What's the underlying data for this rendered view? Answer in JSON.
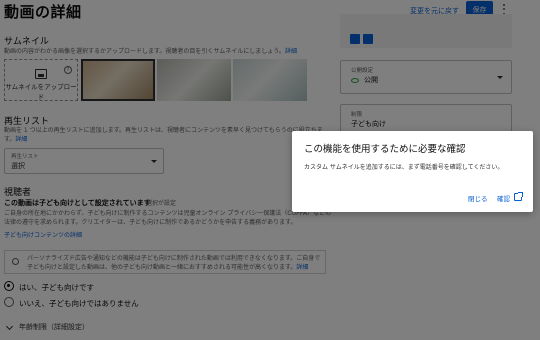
{
  "header": {
    "title": "動画の詳細",
    "undo_label": "変更を元に戻す",
    "save_label": "保存"
  },
  "thumbnail": {
    "title": "サムネイル",
    "desc": "動画の内容がわかる画像を選択するかアップロードします。視聴者の目を引くサムネイルにしましょう。",
    "desc_link": "詳細",
    "upload_label": "サムネイルをアップロード",
    "info_symbol": "?"
  },
  "playlist": {
    "title": "再生リスト",
    "desc_line1": "動画を 1 つ以上の再生リストに追加します。再生リストは、視聴者にコンテンツを素早く見つけてもらうのに役立ちます。",
    "desc_link": "詳細",
    "select_label": "再生リスト",
    "select_value": "選択"
  },
  "audience": {
    "title": "視聴者",
    "status": "この動画は子ども向けとして設定されています",
    "change_label": "選択が設定",
    "desc": "ご自身の所在地にかかわらず、子ども向けに制作するコンテンツは児童オンライン プライバシー保護法（COPPA）などの法律の遵守を求められます。クリエイターは、子ども向けに制作であるかどうかを申告する義務があります。",
    "desc_link": "子ども向けコンテンツの詳細",
    "note": "パーソナライズド広告や通知などの機能は子ども向けに制作された動画では利用できなくなります。ご自身で子ども向けと設定した動画は、他の子ども向け動画と一緒におすすめされる可能性が高くなります。",
    "note_link": "詳細",
    "option_yes": "はい、子ども向けです",
    "option_no": "いいえ、子ども向けではありません",
    "age_restriction": "年齢制限（詳細設定）"
  },
  "right_panel": {
    "visibility_label": "公開設定",
    "visibility_value": "公開",
    "audience_label": "制限",
    "audience_value": "子ども向け"
  },
  "dialog": {
    "title": "この機能を使用するために必要な確認",
    "body": "カスタム サムネイルを追加するには、まず電話番号を確認してください。",
    "close_label": "閉じる",
    "confirm_label": "確認"
  },
  "colors": {
    "accent": "#065fd4",
    "public_icon": "#2ba640",
    "scrim": "rgba(0,0,0,0.5)"
  }
}
